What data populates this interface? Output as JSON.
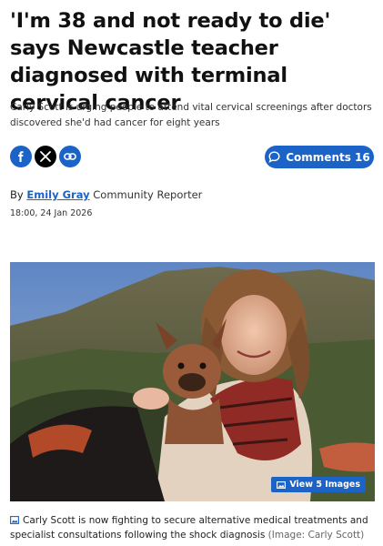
{
  "article": {
    "headline": "'I'm 38 and not ready to die' says Newcastle teacher diagnosed with terminal cervical cancer",
    "standfirst": "Carly Scott is urging people to attend vital cervical screenings after doctors discovered she'd had cancer for eight years"
  },
  "share": {
    "facebook_icon": "facebook-icon",
    "x_icon": "x-twitter-icon",
    "link_icon": "link-icon",
    "comments_label": "Comments 16"
  },
  "byline": {
    "prefix": "By",
    "author": "Emily Gray",
    "role": "Community Reporter",
    "timestamp": "18:00, 24 Jan 2026"
  },
  "image": {
    "view_label": "View 5 Images",
    "caption": "Carly Scott is now fighting to secure alternative medical treatments and specialist consultations following the shock diagnosis",
    "credit": "(Image: Carly Scott)"
  },
  "colors": {
    "brand_blue": "#1b63c6",
    "text": "#111111"
  }
}
